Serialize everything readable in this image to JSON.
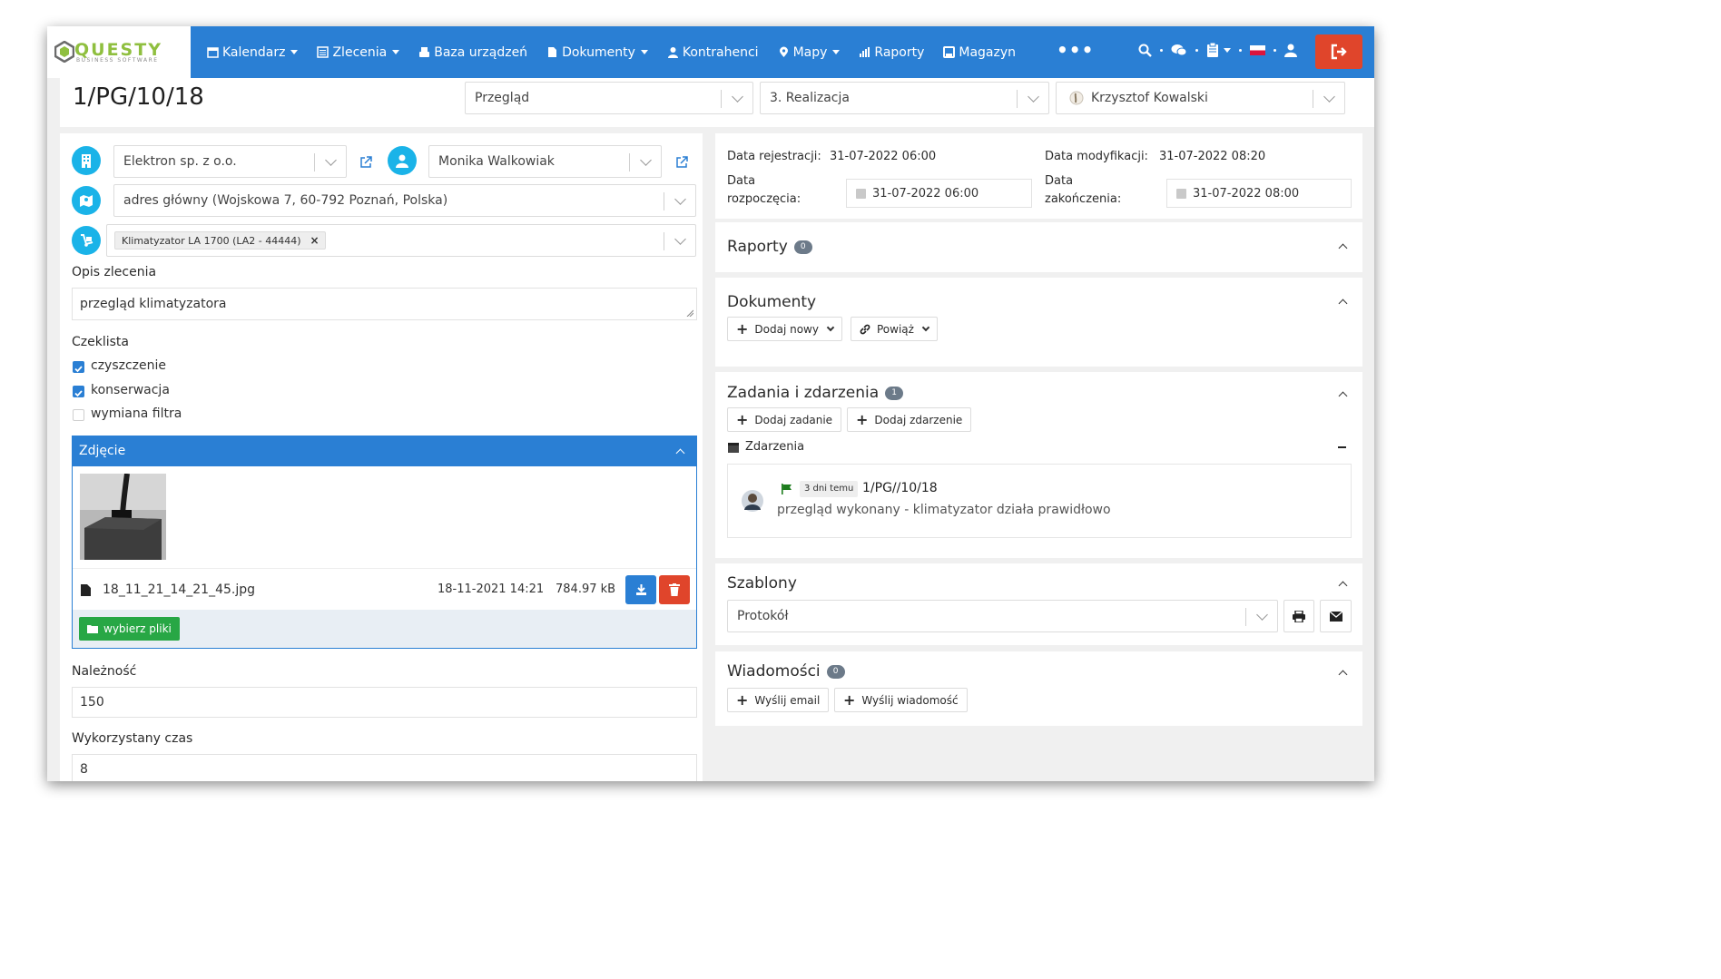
{
  "brand": {
    "name": "QUESTY",
    "subtitle": "BUSINESS SOFTWARE"
  },
  "nav": [
    {
      "label": "Kalendarz",
      "icon": "calendar-icon",
      "dropdown": true
    },
    {
      "label": "Zlecenia",
      "icon": "list-icon",
      "dropdown": true
    },
    {
      "label": "Baza urządzeń",
      "icon": "printer-icon",
      "dropdown": false
    },
    {
      "label": "Dokumenty",
      "icon": "file-icon",
      "dropdown": true
    },
    {
      "label": "Kontrahenci",
      "icon": "user-icon",
      "dropdown": false
    },
    {
      "label": "Mapy",
      "icon": "map-marker-icon",
      "dropdown": true
    },
    {
      "label": "Raporty",
      "icon": "bar-chart-icon",
      "dropdown": false
    },
    {
      "label": "Magazyn",
      "icon": "box-icon",
      "dropdown": false
    }
  ],
  "nav_more": "•••",
  "colors": {
    "primary": "#2a7fd4",
    "accent": "#1ab3e8",
    "danger": "#e0452b",
    "success": "#28a745",
    "brand_green": "#8fbf3f"
  },
  "header": {
    "order_number": "1/PG/10/18",
    "type_select": "Przegląd",
    "stage_select": "3. Realizacja",
    "assignee_select": "Krzysztof Kowalski"
  },
  "left": {
    "client": "Elektron sp. z o.o.",
    "contact": "Monika Walkowiak",
    "address": "adres główny (Wojskowa 7, 60-792 Poznań, Polska)",
    "device_tag": "Klimatyzator LA 1700 (LA2 - 44444)",
    "description_label": "Opis zlecenia",
    "description_value": "przegląd klimatyzatora",
    "checklist_label": "Czeklista",
    "checklist": [
      {
        "label": "czyszczenie",
        "checked": true
      },
      {
        "label": "konserwacja",
        "checked": true
      },
      {
        "label": "wymiana filtra",
        "checked": false
      }
    ],
    "photo_panel_title": "Zdjęcie",
    "file": {
      "name": "18_11_21_14_21_45.jpg",
      "date": "18-11-2021 14:21",
      "size": "784.97 kB"
    },
    "pick_files_label": "wybierz pliki",
    "amount_label": "Należność",
    "amount_value": "150",
    "time_label": "Wykorzystany czas",
    "time_value": "8"
  },
  "right": {
    "reg_date_label": "Data rejestracji:",
    "reg_date_value": "31-07-2022 06:00",
    "mod_date_label": "Data modyfikacji:",
    "mod_date_value": "31-07-2022 08:20",
    "start_label_1": "Data",
    "start_label_2": "rozpoczęcia:",
    "start_value": "31-07-2022 06:00",
    "end_label_1": "Data",
    "end_label_2": "zakończenia:",
    "end_value": "31-07-2022 08:00",
    "reports": {
      "title": "Raporty",
      "count": "0"
    },
    "documents": {
      "title": "Dokumenty",
      "add_new": "Dodaj nowy",
      "link": "Powiąż"
    },
    "tasks": {
      "title": "Zadania i zdarzenia",
      "count": "1",
      "add_task": "Dodaj zadanie",
      "add_event": "Dodaj zdarzenie",
      "events_label": "Zdarzenia",
      "event": {
        "time_badge": "3 dni temu",
        "ref": "1/PG//10/18",
        "text": "przegląd wykonany - klimatyzator działa prawidłowo"
      }
    },
    "templates": {
      "title": "Szablony",
      "select_value": "Protokół"
    },
    "messages": {
      "title": "Wiadomości",
      "count": "0",
      "send_email": "Wyślij email",
      "send_message": "Wyślij wiadomość"
    }
  }
}
